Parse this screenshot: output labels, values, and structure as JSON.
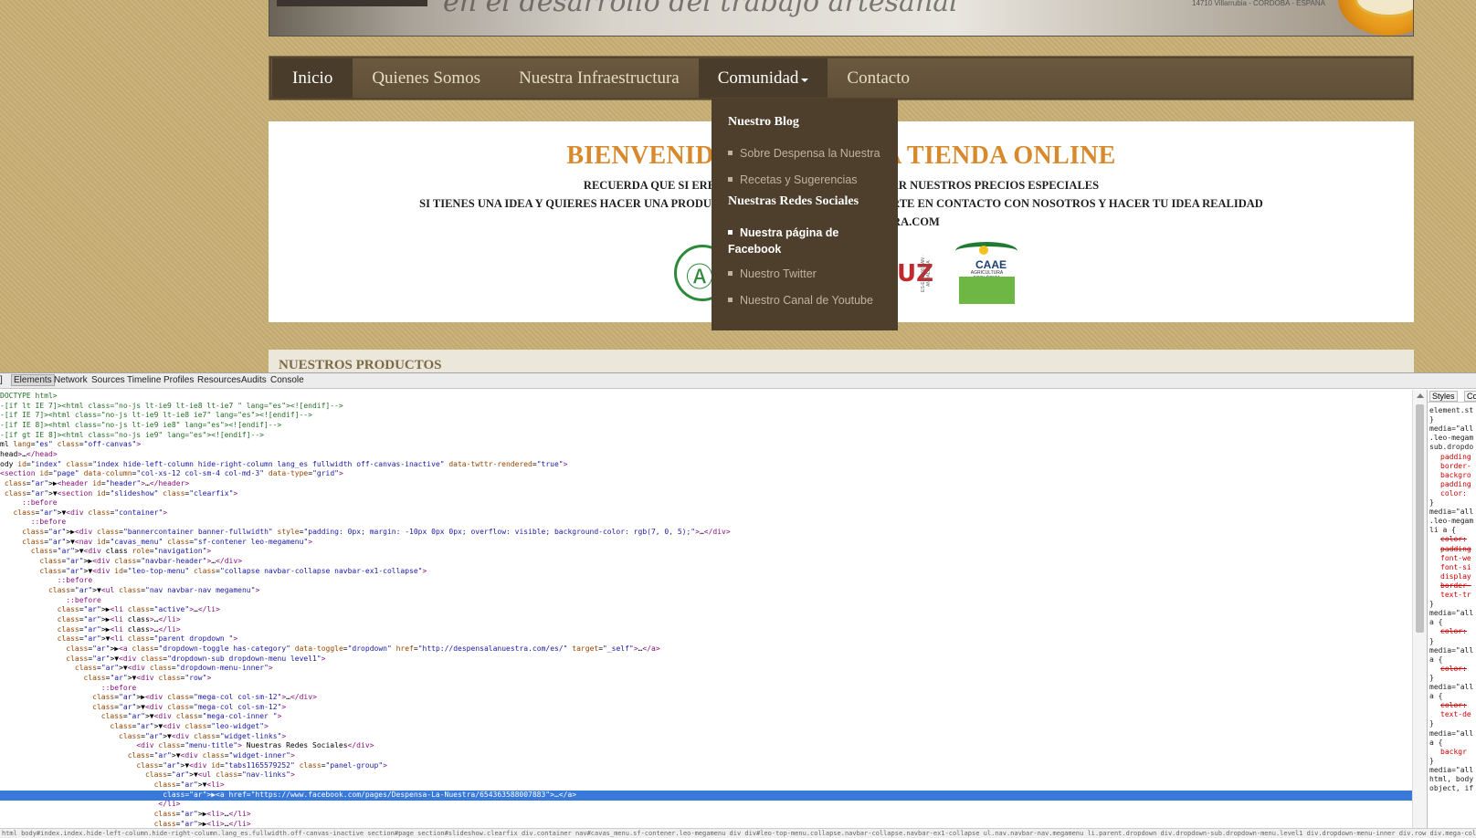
{
  "site": {
    "banner": {
      "script_text": "en el desarrollo del trabajo artesanal",
      "address_text": "14710 Villarrubia - CÓRDOBA - ESPAÑA"
    },
    "nav": [
      {
        "label": "Inicio",
        "state": "active"
      },
      {
        "label": "Quienes Somos",
        "state": "normal"
      },
      {
        "label": "Nuestra Infraestructura",
        "state": "normal"
      },
      {
        "label": "Comunidad",
        "state": "open",
        "has_caret": true
      },
      {
        "label": "Contacto",
        "state": "normal"
      }
    ],
    "welcome": {
      "title": "BIENVENIDOS A NUESTRA TIENDA ONLINE",
      "line1": "RECUERDA QUE SI ERES MAYORISTA PUEDES SOLICITAR NUESTROS PRECIOS ESPECIALES",
      "line2": "SI  TIENES UNA IDEA Y QUIERES HACER UNA PRODUCCIÓN PROPIA NO DUDES PONERTE EN CONTACTO CON NOSOTROS Y HACER TU IDEA REALIDAD",
      "line3": "WWW.DESPENSALANUESTRA.COM",
      "logo_red_text": "UZ",
      "logo_caae_text": "CAAE",
      "logo_caae_sub": "AGRICULTURA ECOLÓGICA",
      "logo_caae_vertical": "ES-ECO-001-AN · ANDALUCÍA"
    },
    "products_title": "NUESTROS PRODUCTOS",
    "dropdown": {
      "heading_blog": "Nuestro Blog",
      "blog_links": [
        "Sobre Despensa la Nuestra",
        "Recetas y Sugerencias"
      ],
      "heading_social": "Nuestras Redes Sociales",
      "social_links": [
        "Nuestra página de Facebook",
        "Nuestro Twitter",
        "Nuestro Canal de Youtube"
      ]
    }
  },
  "devtools": {
    "tabs": [
      "Elements",
      "Network",
      "Sources",
      "Timeline",
      "Profiles",
      "Resources",
      "Audits",
      "Console"
    ],
    "active_tab": "Elements",
    "side_tabs": [
      "Styles",
      "Co"
    ],
    "tree": [
      "DOCTYPE html>",
      "-[if lt IE 7]><html class=\"no-js lt-ie9 lt-ie8 lt-ie7 \" lang=\"es\"><![endif]-->",
      "-[if IE 7]><html class=\"no-js lt-ie9 lt-ie8 ie7\" lang=\"es\"><![endif]-->",
      "-[if IE 8]><html class=\"no-js lt-ie9 ie8\" lang=\"es\"><![endif]-->",
      "-[if gt IE 8]><html class=\"no-js ie9\" lang=\"es\"><![endif]-->",
      "ml lang=\"es\" class=\"off-canvas\">",
      "head>…</head>",
      "ody id=\"index\" class=\"index hide-left-column hide-right-column lang_es fullwidth off-canvas-inactive\" data-twttr-rendered=\"true\">",
      "<section id=\"page\" data-column=\"col-xs-12 col-sm-4 col-md-3\" data-type=\"grid\">",
      " ▶<header id=\"header\">…</header>",
      " ▼<section id=\"slideshow\" class=\"clearfix\">",
      "     ::before",
      "   ▼<div class=\"container\">",
      "       ::before",
      "     ▶<div class=\"bannercontainer banner-fullwidth\" style=\"padding: 0px; margin: -10px 0px 0px; overflow: visible; background-color: rgb(7, 0, 5);\">…</div>",
      "     ▼<nav id=\"cavas_menu\" class=\"sf-contener leo-megamenu\">",
      "       ▼<div class role=\"navigation\">",
      "         ▶<div class=\"navbar-header\">…</div>",
      "         ▼<div id=\"leo-top-menu\" class=\"collapse navbar-collapse navbar-ex1-collapse\">",
      "             ::before",
      "           ▼<ul class=\"nav navbar-nav megamenu\">",
      "               ::before",
      "             ▶<li class=\"active\">…</li>",
      "             ▶<li class>…</li>",
      "             ▶<li class>…</li>",
      "             ▼<li class=\"parent dropdown \">",
      "               ▶<a class=\"dropdown-toggle has-category\" data-toggle=\"dropdown\" href=\"http://despensalanuestra.com/es/\" target=\"_self\">…</a>",
      "               ▼<div class=\"dropdown-sub dropdown-menu level1\">",
      "                 ▼<div class=\"dropdown-menu-inner\">",
      "                   ▼<div class=\"row\">",
      "                       ::before",
      "                     ▶<div class=\"mega-col col-sm-12\">…</div>",
      "                     ▼<div class=\"mega-col col-sm-12\">",
      "                       ▼<div class=\"mega-col-inner \">",
      "                         ▼<div class=\"leo-widget\">",
      "                           ▼<div class=\"widget-links\">",
      "                               <div class=\"menu-title\"> Nuestras Redes Sociales</div>",
      "                             ▼<div class=\"widget-inner\">",
      "                               ▼<div id=\"tabs1165579252\" class=\"panel-group\">",
      "                                 ▼<ul class=\"nav-links\">",
      "                                   ▼<li>",
      "                                     ▶<a href=\"https://www.facebook.com/pages/Despensa-La-Nuestra/654363588007883\">…</a>",
      "                                    </li>",
      "                                   ▶<li>…</li>",
      "                                   ▶<li>…</li>"
    ],
    "selected_index": 41,
    "styles": [
      {
        "t": "element.st",
        "k": "sel"
      },
      {
        "t": "}",
        "k": "brace"
      },
      {
        "t": "media=\"all",
        "k": "sel"
      },
      {
        "t": ".leo-megam",
        "k": "sel"
      },
      {
        "t": "sub.dropdo",
        "k": "sel"
      },
      {
        "t": "padding",
        "k": "red"
      },
      {
        "t": "border-",
        "k": "red"
      },
      {
        "t": "backgro",
        "k": "red"
      },
      {
        "t": "padding",
        "k": "red"
      },
      {
        "t": "color:",
        "k": "red"
      },
      {
        "t": "}",
        "k": "brace"
      },
      {
        "t": "media=\"all",
        "k": "sel"
      },
      {
        "t": ".leo-megam",
        "k": "sel"
      },
      {
        "t": "li a {",
        "k": "sel"
      },
      {
        "t": "color:",
        "k": "strike"
      },
      {
        "t": "padding",
        "k": "strike"
      },
      {
        "t": "font-we",
        "k": "red"
      },
      {
        "t": "font-si",
        "k": "red"
      },
      {
        "t": "display",
        "k": "red"
      },
      {
        "t": "border-",
        "k": "strike"
      },
      {
        "t": "text-tr",
        "k": "red"
      },
      {
        "t": "}",
        "k": "brace"
      },
      {
        "t": "media=\"all",
        "k": "sel"
      },
      {
        "t": "a {",
        "k": "sel"
      },
      {
        "t": "color:",
        "k": "strike"
      },
      {
        "t": "}",
        "k": "brace"
      },
      {
        "t": "media=\"all",
        "k": "sel"
      },
      {
        "t": "a {",
        "k": "sel"
      },
      {
        "t": "color:",
        "k": "strike"
      },
      {
        "t": "}",
        "k": "brace"
      },
      {
        "t": "media=\"all",
        "k": "sel"
      },
      {
        "t": "a {",
        "k": "sel"
      },
      {
        "t": "color:",
        "k": "strike"
      },
      {
        "t": "text-de",
        "k": "red"
      },
      {
        "t": "}",
        "k": "brace"
      },
      {
        "t": "media=\"all",
        "k": "sel"
      },
      {
        "t": "a {",
        "k": "sel"
      },
      {
        "t": "backgr",
        "k": "red"
      },
      {
        "t": "}",
        "k": "brace"
      },
      {
        "t": "media=\"all",
        "k": "sel"
      },
      {
        "t": "html, body",
        "k": "sel"
      },
      {
        "t": "object, if",
        "k": "sel"
      }
    ],
    "status_text": "html body#index.index.hide-left-column.hide-right-column.lang_es.fullwidth.off-canvas-inactive section#page section#slideshow.clearfix div.container nav#cavas_menu.sf-contener.leo-megamenu div div#leo-top-menu.collapse.navbar-collapse.navbar-ex1-collapse ul.nav.navbar-nav.megamenu li.parent.dropdown div.dropdown-sub.dropdown-menu.level1 div.dropdown-menu-inner div.row div.mega-col.col-sm-12 div.mega-col-inner div.leo-widget div.widget-links div.widget-inner div#tabs1165579252.panel-group ul.nav-links li a"
  }
}
